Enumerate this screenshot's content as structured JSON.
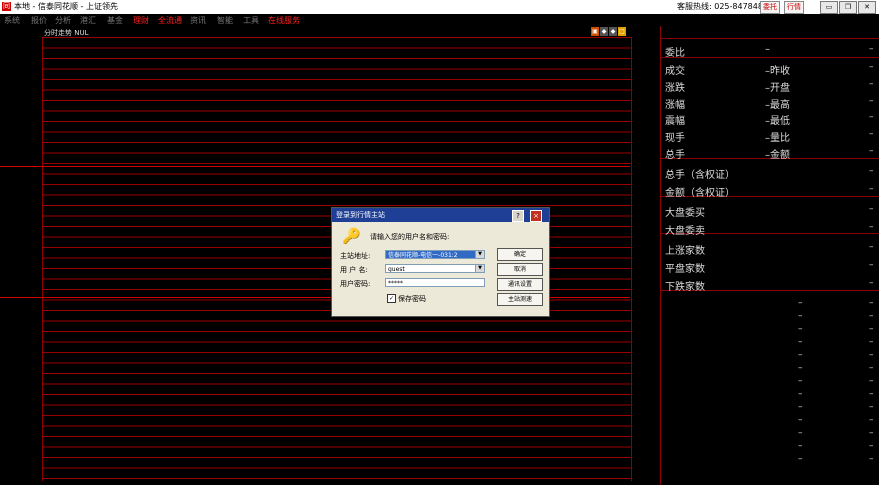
{
  "window": {
    "title": "本地 - 信泰同花顺 - 上证领先",
    "hotline": "客服热线: 025-84784836",
    "buttons": [
      "委托",
      "行情"
    ],
    "controls": [
      "minimize",
      "restore",
      "close"
    ]
  },
  "menu": [
    {
      "label": "系统",
      "accent": false
    },
    {
      "label": "报价",
      "accent": false
    },
    {
      "label": "分析",
      "accent": false
    },
    {
      "label": "港汇",
      "accent": false
    },
    {
      "label": "基金",
      "accent": false
    },
    {
      "label": "理财",
      "accent": true
    },
    {
      "label": "全流通",
      "accent": true
    },
    {
      "label": "资讯",
      "accent": false
    },
    {
      "label": "智能",
      "accent": false
    },
    {
      "label": "工具",
      "accent": false
    },
    {
      "label": "在线服务",
      "accent": true
    }
  ],
  "chart": {
    "title": "分时走势  NUL",
    "tool_icons": [
      "print-icon",
      "zoom-out-icon",
      "zoom-in-icon",
      "close-icon"
    ]
  },
  "panel": {
    "rows": [
      {
        "label": "委比",
        "mid": "–",
        "right": "–"
      },
      {
        "label": "成交",
        "mid": "–昨收",
        "right": "–"
      },
      {
        "label": "涨跌",
        "mid": "–开盘",
        "right": "–"
      },
      {
        "label": "涨幅",
        "mid": "–最高",
        "right": "–"
      },
      {
        "label": "震幅",
        "mid": "–最低",
        "right": "–"
      },
      {
        "label": "现手",
        "mid": "–量比",
        "right": "–"
      },
      {
        "label": "总手",
        "mid": "–金额",
        "right": "–"
      },
      {
        "label": "总手（含权证）",
        "mid": "",
        "right": "–"
      },
      {
        "label": "金额（含权证）",
        "mid": "",
        "right": "–"
      },
      {
        "label": "大盘委买",
        "mid": "",
        "right": "–"
      },
      {
        "label": "大盘委卖",
        "mid": "",
        "right": "–"
      },
      {
        "label": "上涨家数",
        "mid": "",
        "right": "–"
      },
      {
        "label": "平盘家数",
        "mid": "",
        "right": "–"
      },
      {
        "label": "下跌家数",
        "mid": "",
        "right": "–"
      }
    ],
    "trade_dashes": [
      "–",
      "–",
      "–",
      "–",
      "–",
      "–",
      "–",
      "–",
      "–",
      "–",
      "–",
      "–",
      "–"
    ]
  },
  "dialog": {
    "title": "登录到行情主站",
    "prompt": "请输入您的用户名和密码:",
    "fields": {
      "server": {
        "label": "主站地址:",
        "value": "信泰同花顺-电信一-031:2"
      },
      "username": {
        "label": "用 户 名:",
        "value": "guest"
      },
      "password": {
        "label": "用户密码:",
        "value": "*****"
      }
    },
    "save_password": {
      "label": "保存密码",
      "checked": true,
      "mark": "✓"
    },
    "buttons": {
      "ok": "确定",
      "cancel": "取消",
      "proxy": "通讯设置",
      "test": "主站测速"
    },
    "title_buttons": [
      "?",
      "×"
    ]
  }
}
